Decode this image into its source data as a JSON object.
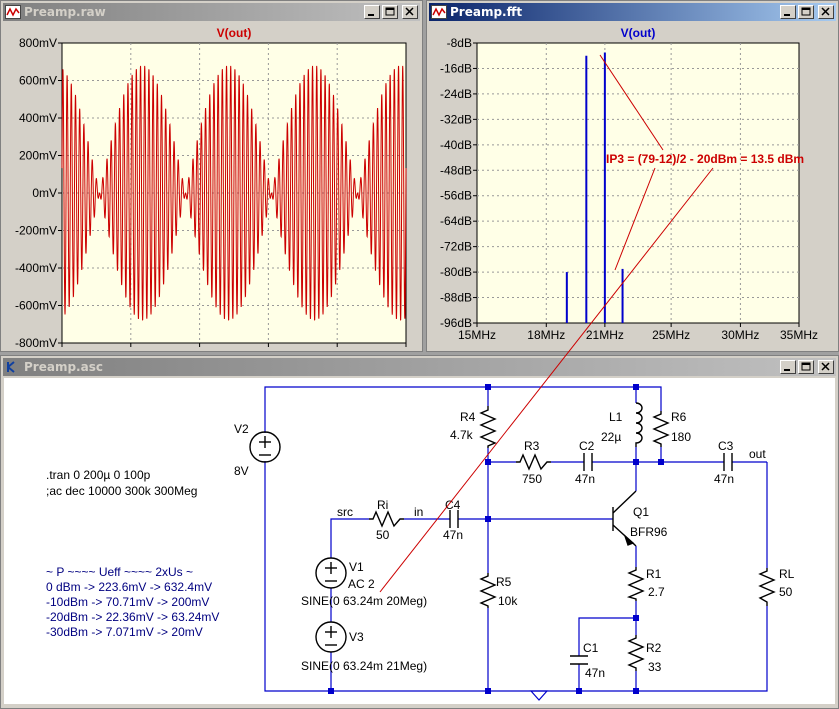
{
  "windows": {
    "raw": {
      "title": "Preamp.raw"
    },
    "fft": {
      "title": "Preamp.fft"
    },
    "asc": {
      "title": "Preamp.asc"
    }
  },
  "raw_plot": {
    "trace": "V(out)",
    "y_ticks": [
      "800mV",
      "600mV",
      "400mV",
      "200mV",
      "0mV",
      "-200mV",
      "-400mV",
      "-600mV",
      "-800mV"
    ],
    "x_ticks": [
      "0.0µs",
      "0.8µs",
      "1.6µs",
      "2.4µs",
      "3.2µs",
      "4.0µs"
    ]
  },
  "fft_plot": {
    "trace": "V(out)",
    "y_ticks": [
      "-8dB",
      "-16dB",
      "-24dB",
      "-32dB",
      "-40dB",
      "-48dB",
      "-56dB",
      "-64dB",
      "-72dB",
      "-80dB",
      "-88dB",
      "-96dB"
    ],
    "x_ticks": [
      "15MHz",
      "18MHz",
      "21MHz",
      "25MHz",
      "30MHz",
      "35MHz"
    ],
    "annotation": "IP3 = (79-12)/2 - 20dBm = 13.5 dBm"
  },
  "chart_data": [
    {
      "type": "line",
      "title": "V(out)",
      "ylabel": "",
      "xlabel": "",
      "x_unit": "µs",
      "y_unit": "mV",
      "xlim": [
        0,
        4.0
      ],
      "ylim": [
        -800,
        800
      ],
      "series": [
        {
          "name": "V(out)",
          "carrier_MHz": [
            20,
            21
          ],
          "amplitude_mV": 680,
          "beat_period_us": 1.0,
          "color": "#cc0000"
        }
      ]
    },
    {
      "type": "bar",
      "title": "V(out)",
      "x_unit": "MHz",
      "y_unit": "dB",
      "xlim_MHz": [
        15,
        35
      ],
      "ylim": [
        -96,
        -8
      ],
      "x_scale": "log",
      "series": [
        {
          "name": "V(out)",
          "color": "#0000cc",
          "x_MHz": [
            19,
            20,
            21,
            22
          ],
          "values_dB": [
            -80,
            -12,
            -11,
            -79
          ]
        }
      ]
    }
  ],
  "schematic": {
    "labels": {
      "v2": "V2",
      "v2_val": "8V",
      "r4": "R4",
      "r4_val": "4.7k",
      "l1": "L1",
      "l1_val": "22µ",
      "r6": "R6",
      "r6_val": "180",
      "r3": "R3",
      "r3_val": "750",
      "c2": "C2",
      "c2_val": "47n",
      "c3": "C3",
      "c3_val": "47n",
      "out": "out",
      "src": "src",
      "ri": "Ri",
      "ri_val": "50",
      "in": "in",
      "c4": "C4",
      "c4_val": "47n",
      "q1": "Q1",
      "q1_val": "BFR96",
      "v1": "V1",
      "v1_val": "AC 2",
      "v1_sine": "SINE(0 63.24m 20Meg)",
      "r5": "R5",
      "r5_val": "10k",
      "r1": "R1",
      "r1_val": "2.7",
      "rl": "RL",
      "rl_val": "50",
      "c1": "C1",
      "c1_val": "47n",
      "r2": "R2",
      "r2_val": "33",
      "v3": "V3",
      "v3_sine": "SINE(0 63.24m 21Meg)"
    },
    "directives": [
      ".tran 0 200µ 0 100p",
      ";ac dec 10000 300k 300Meg"
    ],
    "comments": [
      "~ P ~~~~ Ueff ~~~~ 2xUs ~",
      "0 dBm -> 223.6mV -> 632.4mV",
      "-10dBm -> 70.71mV -> 200mV",
      "-20dBm -> 22.36mV -> 63.24mV",
      "-30dBm -> 7.071mV -> 20mV"
    ]
  },
  "colors": {
    "plot_bg": "#ffffe7",
    "raw_trace": "#cc0000",
    "fft_trace": "#0000cc",
    "wire": "#0000cc",
    "annotation": "#cc0000",
    "comment": "#000080"
  }
}
